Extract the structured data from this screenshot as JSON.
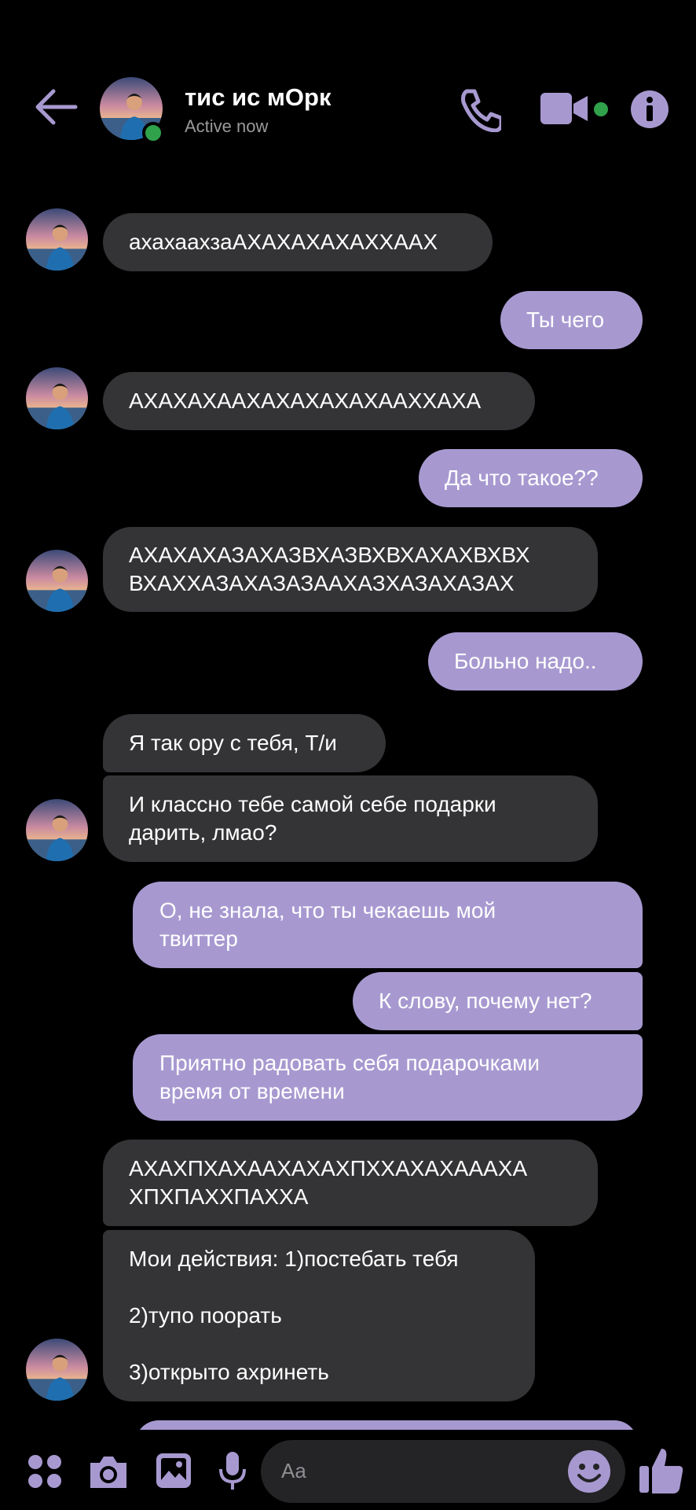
{
  "header": {
    "contact_name": "тис ис мОрк",
    "status": "Active now"
  },
  "messages": [
    {
      "from": "them",
      "lines": [
        "ахахаахзаАХАХАХАХАХХААХ"
      ]
    },
    {
      "from": "me",
      "lines": [
        "Ты чего"
      ]
    },
    {
      "from": "them",
      "lines": [
        "АХАХАХААХАХАХАХАХААХХАХА"
      ]
    },
    {
      "from": "me",
      "lines": [
        "Да что такое??"
      ]
    },
    {
      "from": "them",
      "lines": [
        "АХАХАХАЗАХАЗВХАЗВХВХАХАХВХВХ",
        "ВХАХХАЗАХАЗАЗААХАЗХАЗАХАЗАХ"
      ]
    },
    {
      "from": "me",
      "lines": [
        "Больно надо.."
      ]
    },
    {
      "from": "them",
      "lines": [
        "Я так ору с тебя, Т/и"
      ]
    },
    {
      "from": "them",
      "lines": [
        "И классно тебе самой себе подарки",
        "дарить, лмао?"
      ]
    },
    {
      "from": "me",
      "lines": [
        "О, не знала, что ты чекаешь мой",
        "твиттер"
      ]
    },
    {
      "from": "me",
      "lines": [
        "К слову, почему нет?"
      ]
    },
    {
      "from": "me",
      "lines": [
        "Приятно радовать себя подарочками",
        "время от времени"
      ]
    },
    {
      "from": "them",
      "lines": [
        "АХАХПХАХААХАХАХПХХАХАХАААХА",
        "ХПХПАХХПАХХА"
      ]
    },
    {
      "from": "them",
      "lines": [
        "Мои действия: 1)постебать тебя",
        "",
        "2)тупо поорать",
        "",
        "3)открыто ахринеть"
      ]
    }
  ],
  "composer": {
    "placeholder": "Aa"
  },
  "colors": {
    "incoming_bubble": "#343436",
    "outgoing_bubble": "#a799d0",
    "accent": "#a799d0",
    "online": "#31a24c"
  },
  "icons": {
    "back": "arrow-left-icon",
    "call": "phone-icon",
    "video": "video-camera-icon",
    "info": "info-icon",
    "menu": "four-dots-icon",
    "camera": "camera-icon",
    "gallery": "image-icon",
    "mic": "microphone-icon",
    "emoji": "emoji-icon",
    "like": "thumbs-up-icon"
  }
}
